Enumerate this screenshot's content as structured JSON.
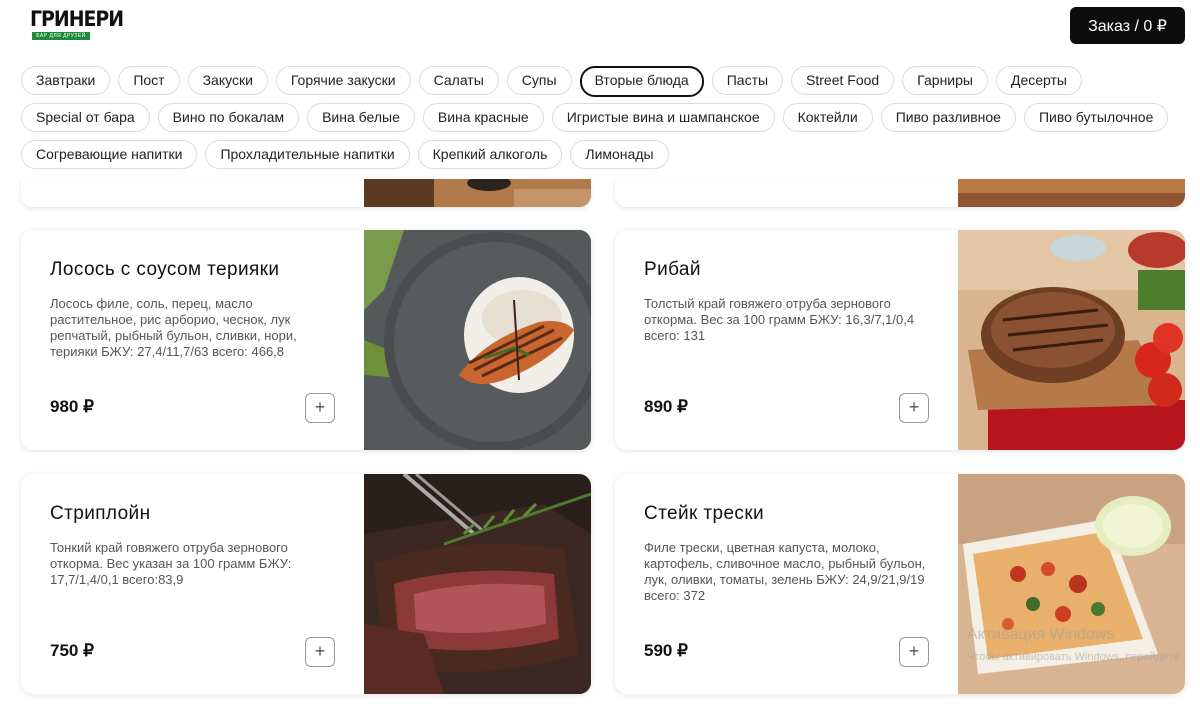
{
  "header": {
    "logo_text": "ГРИНЕРИ",
    "logo_subtitle": "БАР ДЛЯ ДРУЗЕЙ",
    "order_button": "Заказ / 0 ₽"
  },
  "categories": {
    "row1": [
      "Завтраки",
      "Пост",
      "Закуски",
      "Горячие закуски",
      "Салаты",
      "Супы",
      "Вторые блюда",
      "Пасты",
      "Street Food",
      "Гарниры",
      "Десерты"
    ],
    "row2": [
      "Special от бара",
      "Вино по бокалам",
      "Вина белые",
      "Вина красные",
      "Игристые вина и шампанское",
      "Коктейли",
      "Пиво разливное",
      "Пиво бутылочное"
    ],
    "row3": [
      "Согревающие напитки",
      "Прохладительные напитки",
      "Крепкий алкоголь",
      "Лимонады"
    ],
    "active": "Вторые блюда"
  },
  "dishes": [
    {
      "name": "Лосось с соусом терияки",
      "description": "Лосось филе, соль, перец, масло растительное, рис арборио, чеснок, лук репчатый, рыбный бульон, сливки, нори, терияки БЖУ: 27,4/11,7/63 всего: 466,8",
      "price": "980 ₽",
      "add_label": "+"
    },
    {
      "name": "Рибай",
      "description": "Толстый край говяжего отруба зернового откорма. Вес за 100 грамм БЖУ: 16,3/7,1/0,4 всего: 131",
      "price": "890 ₽",
      "add_label": "+"
    },
    {
      "name": "Стриплойн",
      "description": "Тонкий край говяжего отруба зернового откорма. Вес указан за 100 грамм БЖУ: 17,7/1,4/0,1 всего:83,9",
      "price": "750 ₽",
      "add_label": "+"
    },
    {
      "name": "Стейк трески",
      "description": "Филе трески, цветная капуста, молоко, картофель, сливочное масло, рыбный бульон, лук, оливки, томаты, зелень БЖУ: 24,9/21,9/19 всего: 372",
      "price": "590 ₽",
      "add_label": "+"
    }
  ],
  "watermark": {
    "line1": "Активация Windows",
    "line2": "Чтобы активировать Windows, перейдите"
  }
}
